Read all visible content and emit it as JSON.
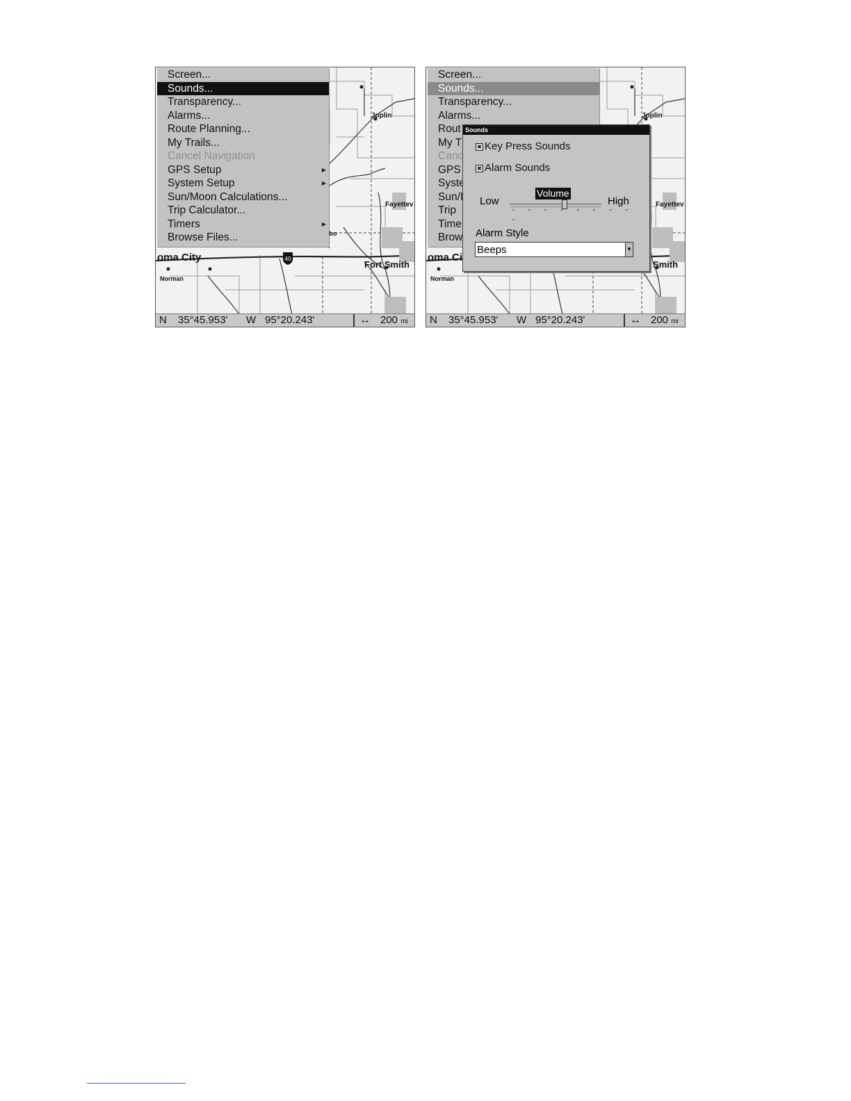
{
  "map": {
    "labels": {
      "joplin": "Joplin",
      "fayetteville": "Fayettev",
      "oklahoma_city": "oma City",
      "fort_smith": "Fort Smith",
      "fort_smith_right": "t Smith",
      "norman": "Norman",
      "interstate": "40",
      "tbo": "Tbo"
    }
  },
  "left_panel": {
    "menu": {
      "items": [
        {
          "label": "Screen...",
          "state": "normal",
          "submenu": false
        },
        {
          "label": "Sounds...",
          "state": "selected",
          "submenu": false
        },
        {
          "label": "Transparency...",
          "state": "normal",
          "submenu": false
        },
        {
          "label": "Alarms...",
          "state": "normal",
          "submenu": false
        },
        {
          "label": "Route Planning...",
          "state": "normal",
          "submenu": false
        },
        {
          "label": "My Trails...",
          "state": "normal",
          "submenu": false
        },
        {
          "label": "Cancel Navigation",
          "state": "disabled",
          "submenu": false
        },
        {
          "label": "GPS Setup",
          "state": "normal",
          "submenu": true
        },
        {
          "label": "System Setup",
          "state": "normal",
          "submenu": true
        },
        {
          "label": "Sun/Moon Calculations...",
          "state": "normal",
          "submenu": false
        },
        {
          "label": "Trip Calculator...",
          "state": "normal",
          "submenu": false
        },
        {
          "label": "Timers",
          "state": "normal",
          "submenu": true
        },
        {
          "label": "Browse Files...",
          "state": "normal",
          "submenu": false
        }
      ]
    }
  },
  "right_panel": {
    "menu_visible": [
      "Screen...",
      "Sounds...",
      "Transparency...",
      "Alarms...",
      "Rout",
      "My T",
      "Canc",
      "GPS",
      "Syste",
      "Sun/I",
      "Trip",
      "Time",
      "Brow"
    ],
    "dialog": {
      "title": "Sounds",
      "key_press_sounds": {
        "label": "Key Press Sounds",
        "checked": true
      },
      "alarm_sounds": {
        "label": "Alarm Sounds",
        "checked": true
      },
      "volume": {
        "title": "Volume",
        "low_label": "Low",
        "high_label": "High",
        "level": 0.6
      },
      "alarm_style": {
        "label": "Alarm Style",
        "value": "Beeps"
      }
    }
  },
  "status_bar": {
    "lat_hemi": "N",
    "lat": "35°45.953'",
    "lon_hemi": "W",
    "lon": "95°20.243'",
    "scale_arrow": "↔",
    "scale_value": "200",
    "scale_unit": "mi"
  },
  "icons": {
    "submenu_arrow": "right-triangle",
    "check": "x-mark",
    "dropdown": "down-triangle"
  }
}
